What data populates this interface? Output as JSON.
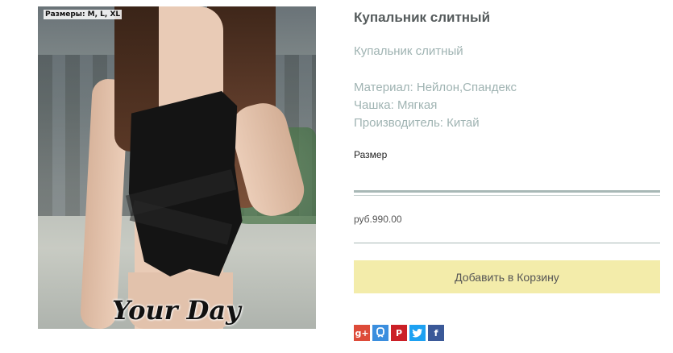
{
  "product": {
    "image_caption": "Размеры: M, L, XL",
    "watermark": "Your Day",
    "title": "Купальник слитный",
    "subtitle": "Купальник слитный",
    "specs": [
      "Материал: Нейлон,Спандекс",
      "Чашка: Мягкая",
      "Производитель: Китай"
    ],
    "size_label": "Размер",
    "price": "руб.990.00",
    "add_to_cart_label": "Добавить в Корзину"
  },
  "share": [
    {
      "name": "google-plus-icon",
      "glyph": "g+",
      "color": "#dd4b39"
    },
    {
      "name": "odnoklassniki-icon",
      "glyph": "",
      "color": "#3b8ede"
    },
    {
      "name": "pinterest-icon",
      "glyph": "P",
      "color": "#cb2027"
    },
    {
      "name": "twitter-icon",
      "glyph": "",
      "color": "#1da1f2"
    },
    {
      "name": "facebook-icon",
      "glyph": "f",
      "color": "#3b5998"
    }
  ],
  "colors": {
    "title": "#555b5c",
    "muted_teal": "#9fb3b2",
    "cart_button": "#f3ecaa",
    "divider": "#a8b8b6"
  }
}
